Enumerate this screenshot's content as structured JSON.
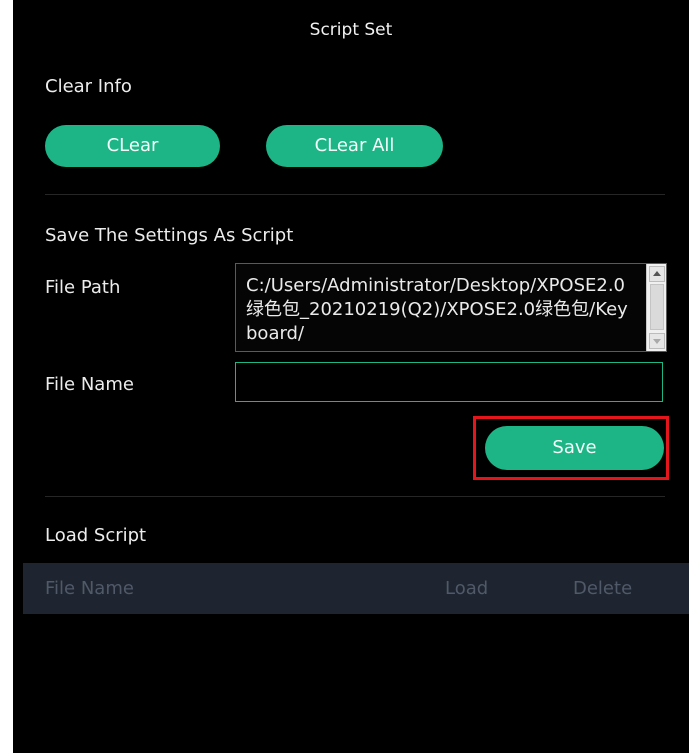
{
  "dialog": {
    "title": "Script Set"
  },
  "clear_info": {
    "heading": "Clear Info",
    "clear_label": "CLear",
    "clear_all_label": "CLear All"
  },
  "save_section": {
    "heading": "Save The Settings As Script",
    "file_path_label": "File Path",
    "file_path_value": "C:/Users/Administrator/Desktop/XPOSE2.0绿色包_20210219(Q2)/XPOSE2.0绿色包/Keyboard/",
    "file_name_label": "File Name",
    "file_name_value": "",
    "save_label": "Save"
  },
  "load_section": {
    "heading": "Load Script",
    "columns": [
      "File Name",
      "Load",
      "Delete"
    ],
    "rows": []
  },
  "colors": {
    "accent": "#1db486",
    "highlight": "#e4161b",
    "background": "#000000",
    "table_header_bg": "#1f2530"
  }
}
